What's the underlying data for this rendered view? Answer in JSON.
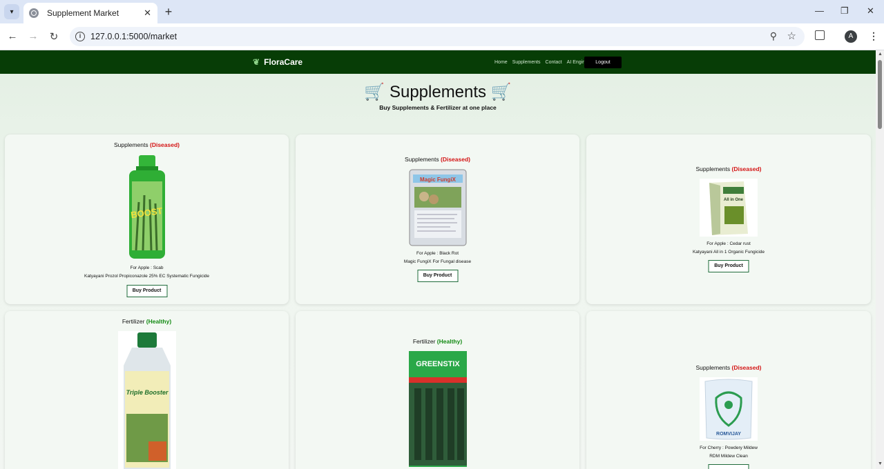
{
  "browser": {
    "tab_title": "Supplement Market",
    "url": "127.0.0.1:5000/market",
    "profile_initial": "A"
  },
  "nav": {
    "brand": "FloraCare",
    "links": [
      "Home",
      "Supplements",
      "Contact",
      "AI Engine"
    ],
    "logout": "Logout"
  },
  "hero": {
    "title": "🛒 Supplements 🛒",
    "subtitle": "Buy Supplements & Fertilizer at one place"
  },
  "products": [
    {
      "category": "Supplements",
      "status": "Diseased",
      "condition": "For Apple : Scab",
      "name": "Katyayani Prozol Propiconazole 25% EC Systematic Fungicide",
      "button": "Buy Product",
      "image_label": "BOOST"
    },
    {
      "category": "Supplements",
      "status": "Diseased",
      "condition": "For Apple : Black Rot",
      "name": "Magic FungiX For Fungal disease",
      "button": "Buy Product",
      "image_label": "Magic FungiX"
    },
    {
      "category": "Supplements",
      "status": "Diseased",
      "condition": "For Apple : Cedar rust",
      "name": "Katyayani All in 1 Organic Fungicide",
      "button": "Buy Product",
      "image_label": "All in One"
    },
    {
      "category": "Fertilizer",
      "status": "Healthy",
      "condition": "",
      "name": "",
      "button": "",
      "image_label": "Triple Booster"
    },
    {
      "category": "Fertilizer",
      "status": "Healthy",
      "condition": "",
      "name": "",
      "button": "",
      "image_label": "GREENSTIX"
    },
    {
      "category": "Supplements",
      "status": "Diseased",
      "condition": "For Cherry : Powdery Mildew",
      "name": "RDM Mildew Clean",
      "button": "",
      "image_label": "ROMVIJAY"
    }
  ]
}
